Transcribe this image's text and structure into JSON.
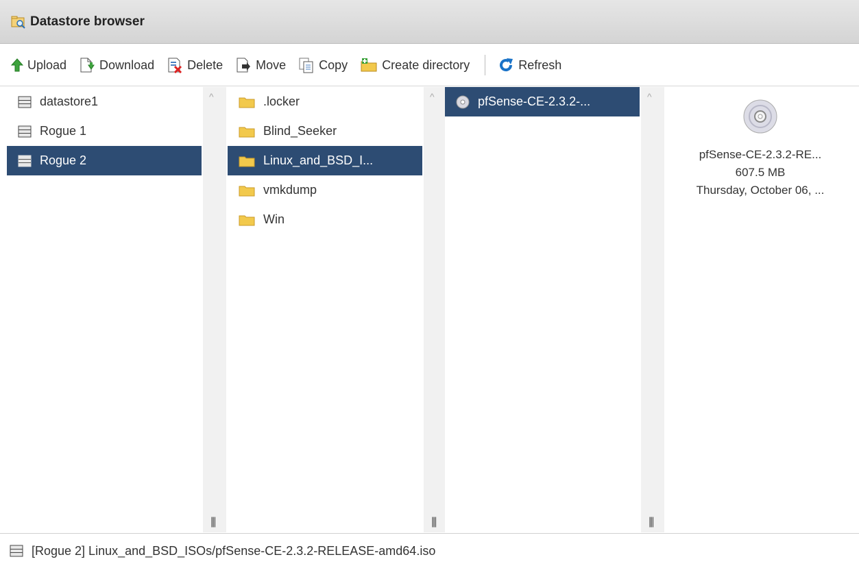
{
  "window": {
    "title": "Datastore browser"
  },
  "toolbar": {
    "upload": "Upload",
    "download": "Download",
    "delete": "Delete",
    "move": "Move",
    "copy": "Copy",
    "create_directory": "Create directory",
    "refresh": "Refresh"
  },
  "datastores": {
    "items": [
      {
        "label": "datastore1",
        "selected": false
      },
      {
        "label": "Rogue 1",
        "selected": false
      },
      {
        "label": "Rogue 2",
        "selected": true
      }
    ]
  },
  "folders": {
    "items": [
      {
        "label": ".locker",
        "selected": false
      },
      {
        "label": "Blind_Seeker",
        "selected": false
      },
      {
        "label": "Linux_and_BSD_I...",
        "selected": true
      },
      {
        "label": "vmkdump",
        "selected": false
      },
      {
        "label": "Win",
        "selected": false
      }
    ]
  },
  "files": {
    "items": [
      {
        "label": "pfSense-CE-2.3.2-...",
        "selected": true,
        "icon": "disc-icon"
      }
    ]
  },
  "details": {
    "name": "pfSense-CE-2.3.2-RE...",
    "size": "607.5 MB",
    "date": "Thursday, October 06, ..."
  },
  "status": {
    "path": "[Rogue 2] Linux_and_BSD_ISOs/pfSense-CE-2.3.2-RELEASE-amd64.iso"
  },
  "colors": {
    "selection": "#2d4c73",
    "folder": "#f2c94c",
    "refresh": "#1a73c8"
  }
}
